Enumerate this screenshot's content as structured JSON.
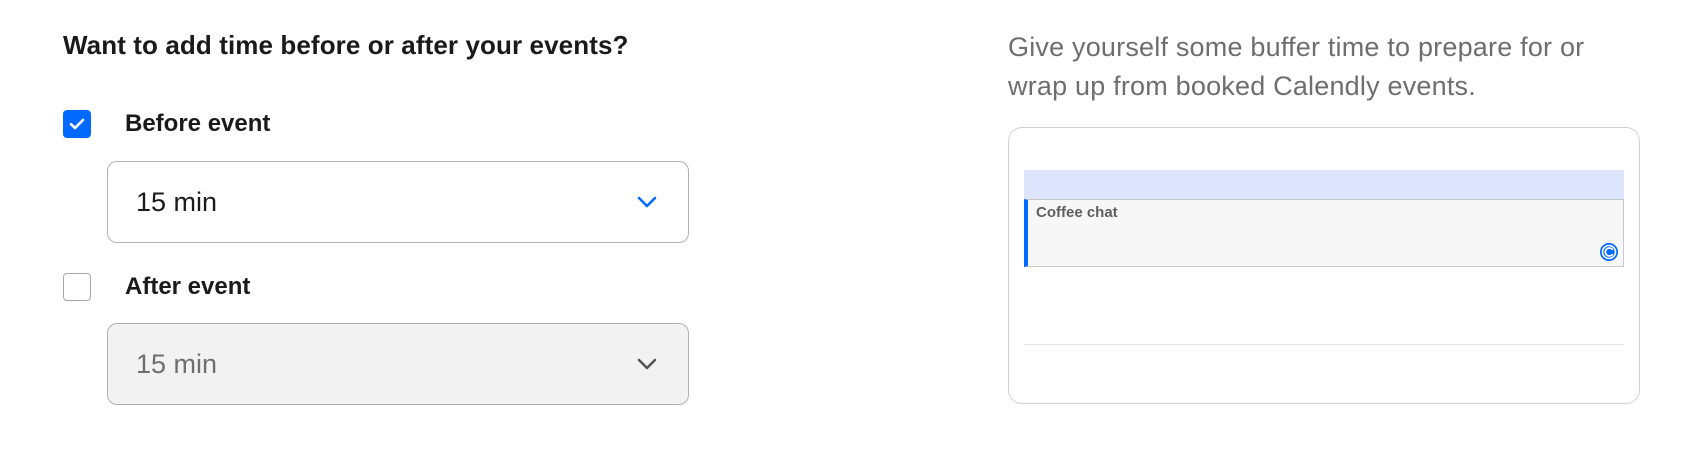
{
  "heading": "Want to add time before or after your events?",
  "before": {
    "label": "Before event",
    "checked": true,
    "value": "15 min"
  },
  "after": {
    "label": "After event",
    "checked": false,
    "value": "15 min"
  },
  "help_text": "Give yourself some buffer time to prepare for or wrap up from booked Calendly events.",
  "preview": {
    "event_title": "Coffee chat",
    "brand_icon": "calendly-logo"
  },
  "colors": {
    "accent": "#0069ff",
    "buffer": "#dde6fd",
    "text_muted": "#6e6e6e",
    "disabled_bg": "#f2f2f2"
  }
}
